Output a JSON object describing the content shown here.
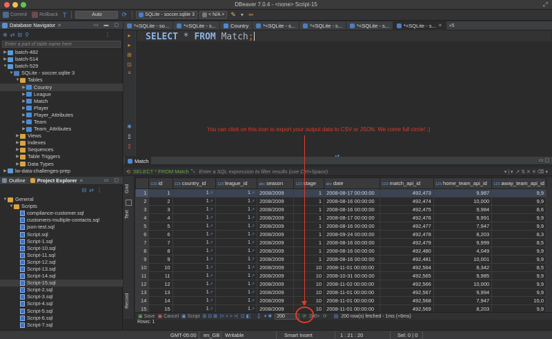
{
  "window": {
    "title": "DBeaver 7.0.4 - <none> Script-15"
  },
  "toolbar": {
    "commit": "Commit",
    "rollback": "Rollback",
    "tx_mode": "Auto",
    "datasource": "SQLite - soccer.sqlite 3",
    "schema": "< N/A >"
  },
  "navigator": {
    "title": "Database Navigator",
    "filter_placeholder": "Enter a part of table name here",
    "items": [
      {
        "label": "batch-482",
        "level": 0,
        "icon": "db",
        "twisty": "▶"
      },
      {
        "label": "batch-514",
        "level": 0,
        "icon": "db",
        "twisty": "▶"
      },
      {
        "label": "batch-529",
        "level": 0,
        "icon": "db",
        "twisty": "▼"
      },
      {
        "label": "SQLite - soccer.sqlite 3",
        "level": 1,
        "icon": "sqlite",
        "twisty": "▼"
      },
      {
        "label": "Tables",
        "level": 2,
        "icon": "folder",
        "twisty": "▼"
      },
      {
        "label": "Country",
        "level": 3,
        "icon": "table",
        "twisty": "▶",
        "selected": true
      },
      {
        "label": "League",
        "level": 3,
        "icon": "table",
        "twisty": "▶"
      },
      {
        "label": "Match",
        "level": 3,
        "icon": "table",
        "twisty": "▶"
      },
      {
        "label": "Player",
        "level": 3,
        "icon": "table",
        "twisty": "▶"
      },
      {
        "label": "Player_Attributes",
        "level": 3,
        "icon": "table",
        "twisty": "▶"
      },
      {
        "label": "Team",
        "level": 3,
        "icon": "table",
        "twisty": "▶"
      },
      {
        "label": "Team_Attributes",
        "level": 3,
        "icon": "table",
        "twisty": "▶"
      },
      {
        "label": "Views",
        "level": 2,
        "icon": "folder",
        "twisty": "▶"
      },
      {
        "label": "Indexes",
        "level": 2,
        "icon": "folder",
        "twisty": "▶"
      },
      {
        "label": "Sequences",
        "level": 2,
        "icon": "folder",
        "twisty": "▶"
      },
      {
        "label": "Table Triggers",
        "level": 2,
        "icon": "folder",
        "twisty": "▶"
      },
      {
        "label": "Data Types",
        "level": 2,
        "icon": "folder",
        "twisty": "▶"
      },
      {
        "label": "lw-data-challenges-prep",
        "level": 0,
        "icon": "db",
        "twisty": "▶"
      }
    ]
  },
  "project": {
    "outline_tab": "Outline",
    "title": "Project Explorer",
    "items": [
      {
        "label": "General",
        "level": 0,
        "icon": "folder",
        "twisty": "▼"
      },
      {
        "label": "Scripts",
        "level": 1,
        "icon": "folder",
        "twisty": "▼"
      },
      {
        "label": "compliance-customer.sql",
        "level": 2,
        "icon": "sql"
      },
      {
        "label": "customers-multiple-contacts.sql",
        "level": 2,
        "icon": "sql"
      },
      {
        "label": "json-test.sql",
        "level": 2,
        "icon": "sql"
      },
      {
        "label": "Script.sql",
        "level": 2,
        "icon": "sql"
      },
      {
        "label": "Script-1.sql",
        "level": 2,
        "icon": "sql"
      },
      {
        "label": "Script-10.sql",
        "level": 2,
        "icon": "sql"
      },
      {
        "label": "Script-11.sql",
        "level": 2,
        "icon": "sql"
      },
      {
        "label": "Script-12.sql",
        "level": 2,
        "icon": "sql"
      },
      {
        "label": "Script-13.sql",
        "level": 2,
        "icon": "sql"
      },
      {
        "label": "Script-14.sql",
        "level": 2,
        "icon": "sql"
      },
      {
        "label": "Script-15.sql",
        "level": 2,
        "icon": "sql",
        "selected": true
      },
      {
        "label": "Script-2.sql",
        "level": 2,
        "icon": "sql"
      },
      {
        "label": "Script-3.sql",
        "level": 2,
        "icon": "sql"
      },
      {
        "label": "Script-4.sql",
        "level": 2,
        "icon": "sql"
      },
      {
        "label": "Script-5.sql",
        "level": 2,
        "icon": "sql"
      },
      {
        "label": "Script-6.sql",
        "level": 2,
        "icon": "sql"
      },
      {
        "label": "Script-7.sql",
        "level": 2,
        "icon": "sql"
      }
    ]
  },
  "editor": {
    "tabs": [
      {
        "label": "*<SQLite - so...",
        "active": false
      },
      {
        "label": "*<SQLite - s...",
        "active": false
      },
      {
        "label": "Country",
        "active": false
      },
      {
        "label": "*<SQLite - s...",
        "active": false
      },
      {
        "label": "*<SQLite - s...",
        "active": false
      },
      {
        "label": "*<SQLite - s...",
        "active": false
      },
      {
        "label": "*<SQLite - s...",
        "active": true
      }
    ],
    "overflow": "»5",
    "sql": {
      "kw1": "SELECT",
      "mid": " * ",
      "kw2": "FROM",
      "tail": " Match",
      "semi": ";"
    }
  },
  "annotation": "You can click on this icon to export your output data to CSV or JSON. We come full circle! ;)",
  "results": {
    "tab": "Match",
    "filter_query": "SELECT * FROM Match",
    "filter_placeholder": "Enter a SQL expression to filter results (use Ctrl+Space)",
    "side_tabs": {
      "grid": "Grid",
      "text": "Text",
      "record": "Record"
    },
    "columns": [
      {
        "name": "id",
        "type": "123"
      },
      {
        "name": "country_id",
        "type": "123"
      },
      {
        "name": "league_id",
        "type": "123"
      },
      {
        "name": "season",
        "type": "abc"
      },
      {
        "name": "stage",
        "type": "123"
      },
      {
        "name": "date",
        "type": "abc"
      },
      {
        "name": "match_api_id",
        "type": "123"
      },
      {
        "name": "home_team_api_id",
        "type": "123"
      },
      {
        "name": "away_team_api_id",
        "type": "123"
      }
    ],
    "rows": [
      [
        "1",
        "1",
        "1",
        "2008/2009",
        "1",
        "2008-08-17 00:00:00",
        "492,473",
        "9,987",
        "9,9"
      ],
      [
        "2",
        "1",
        "1",
        "2008/2009",
        "1",
        "2008-08-16 00:00:00",
        "492,474",
        "10,000",
        "9,9"
      ],
      [
        "3",
        "1",
        "1",
        "2008/2009",
        "1",
        "2008-08-16 00:00:00",
        "492,475",
        "9,984",
        "8,6"
      ],
      [
        "4",
        "1",
        "1",
        "2008/2009",
        "1",
        "2008-08-17 00:00:00",
        "492,476",
        "9,991",
        "9,9"
      ],
      [
        "5",
        "1",
        "1",
        "2008/2009",
        "1",
        "2008-08-16 00:00:00",
        "492,477",
        "7,947",
        "9,9"
      ],
      [
        "6",
        "1",
        "1",
        "2008/2009",
        "1",
        "2008-09-24 00:00:00",
        "492,478",
        "8,203",
        "8,3"
      ],
      [
        "7",
        "1",
        "1",
        "2008/2009",
        "1",
        "2008-08-16 00:00:00",
        "492,479",
        "9,999",
        "8,5"
      ],
      [
        "8",
        "1",
        "1",
        "2008/2009",
        "1",
        "2008-08-16 00:00:00",
        "492,480",
        "4,049",
        "9,9"
      ],
      [
        "9",
        "1",
        "1",
        "2008/2009",
        "1",
        "2008-08-16 00:00:00",
        "492,481",
        "10,001",
        "9,9"
      ],
      [
        "10",
        "1",
        "1",
        "2008/2009",
        "10",
        "2008-11-01 00:00:00",
        "492,564",
        "8,342",
        "8,5"
      ],
      [
        "11",
        "1",
        "1",
        "2008/2009",
        "10",
        "2008-10-31 00:00:00",
        "492,565",
        "9,985",
        "9,9"
      ],
      [
        "12",
        "1",
        "1",
        "2008/2009",
        "10",
        "2008-11-02 00:00:00",
        "492,566",
        "10,000",
        "9,9"
      ],
      [
        "13",
        "1",
        "1",
        "2008/2009",
        "10",
        "2008-11-01 00:00:00",
        "492,567",
        "9,994",
        "9,9"
      ],
      [
        "14",
        "1",
        "1",
        "2008/2009",
        "10",
        "2008-11-01 00:00:00",
        "492,568",
        "7,947",
        "10,0"
      ],
      [
        "15",
        "1",
        "1",
        "2008/2009",
        "10",
        "2008-11-01 00:00:00",
        "492,569",
        "8,203",
        "9,9"
      ],
      [
        "16",
        "1",
        "1",
        "2008/2009",
        "10",
        "2008-11-01 00:00:00",
        "492,570",
        "9,996",
        "9,9"
      ],
      [
        "17",
        "1",
        "1",
        "2008/2009",
        "10",
        "2008-11-01 00:00:00",
        "492,571",
        "4,049",
        "9,9"
      ]
    ],
    "row_numbers": [
      "1",
      "2",
      "3",
      "4",
      "5",
      "6",
      "7",
      "8",
      "9",
      "10",
      "11",
      "12",
      "13",
      "14",
      "15",
      "16",
      "17"
    ],
    "bottom": {
      "save": "Save",
      "cancel": "Cancel",
      "script": "Script",
      "fetch_size": "200",
      "fetch_more": "200+",
      "fetched": "200 row(s) fetched - 1ms (+6ms)",
      "rows_label": "Rows: 1"
    }
  },
  "status": {
    "timezone": "GMT-05:00",
    "locale": "en_GB",
    "mode": "Writable",
    "insert": "Smart Insert",
    "position": "1 : 21 : 20",
    "selection": "Sel: 0 | 0"
  },
  "colors": {
    "accent_red": "#e23b2a",
    "selection": "#3b4453",
    "editor_bg": "#2b2b2b"
  }
}
